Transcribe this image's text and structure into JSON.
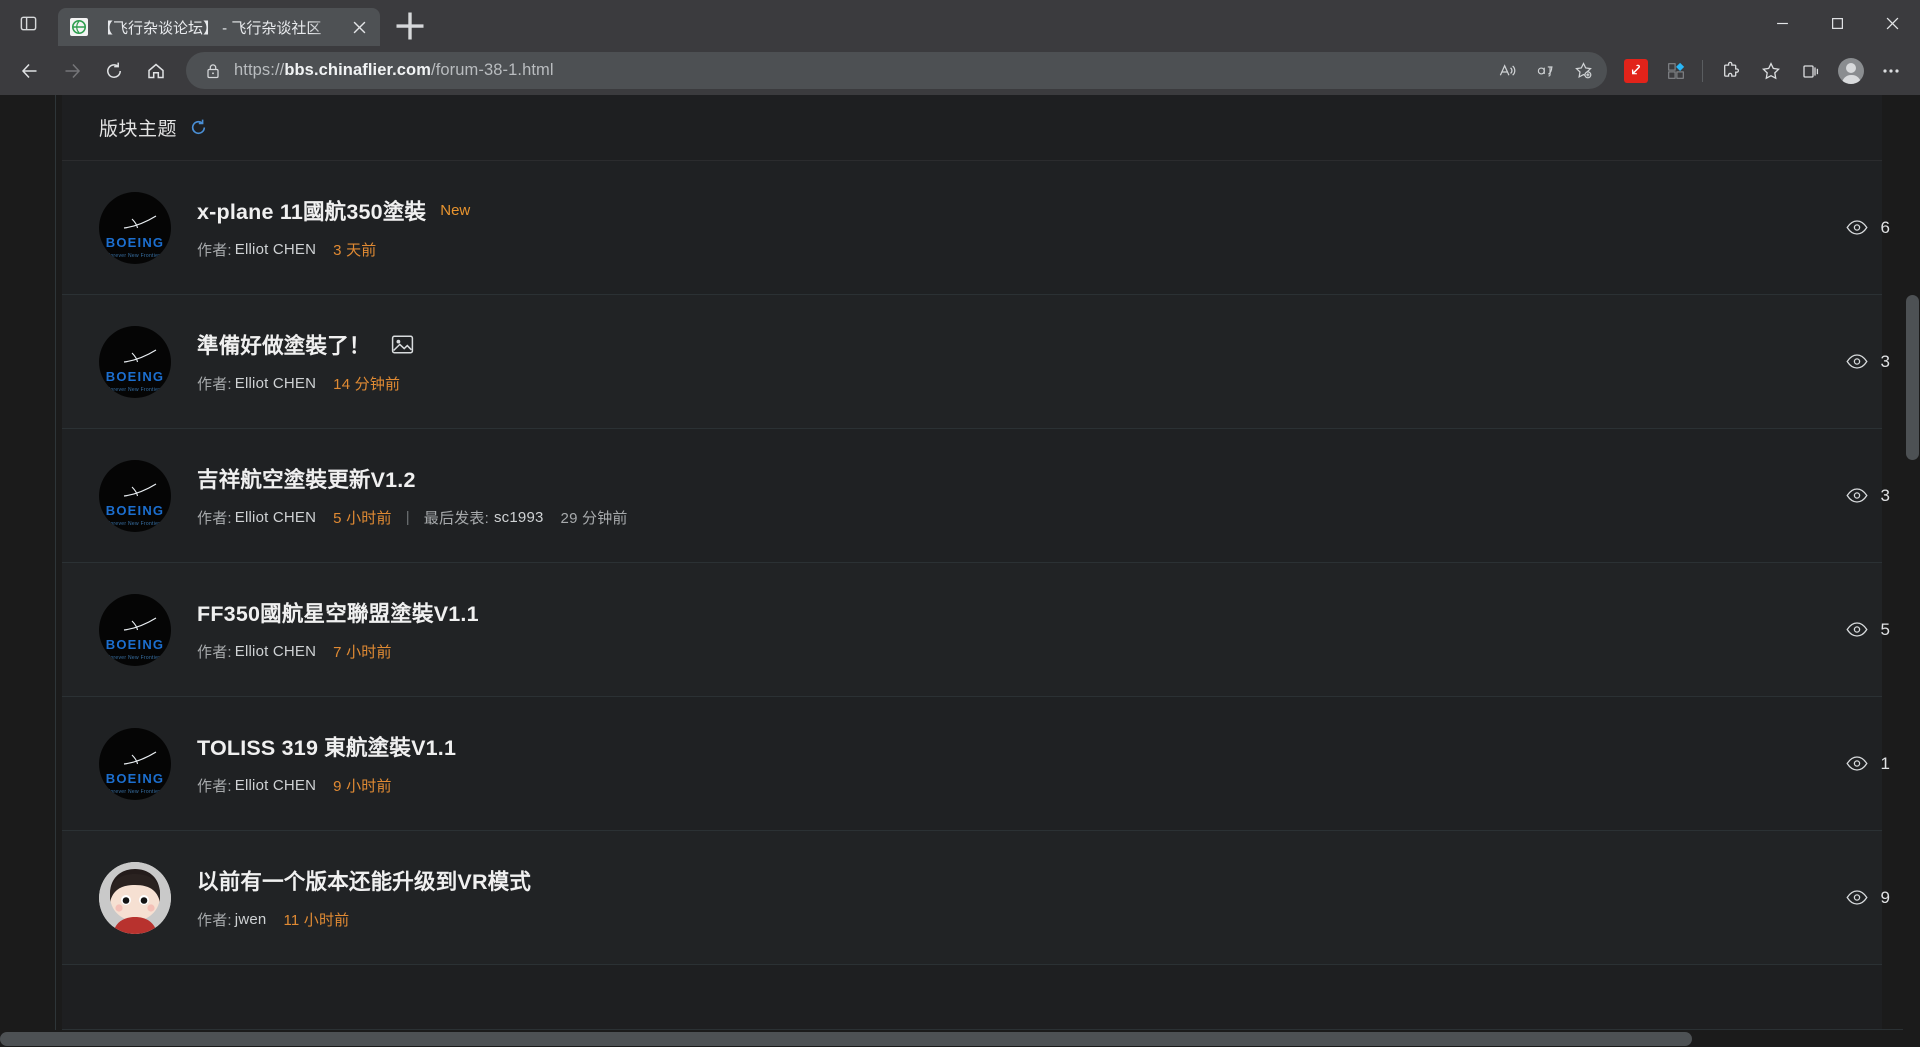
{
  "browser": {
    "tab": {
      "title": "【飞行杂谈论坛】 - 飞行杂谈社区",
      "favicon_name": "site-favicon",
      "close_label": "×"
    },
    "new_tab_label": "+",
    "address": {
      "url_scheme": "https://",
      "url_domain": "bbs.chinaflier.com",
      "url_path": "/forum-38-1.html",
      "full_url": "https://bbs.chinaflier.com/forum-38-1.html"
    },
    "toolbar_icons": [
      "read-aloud-icon",
      "translate-icon",
      "add-favorite-icon",
      "pdf-extension-icon",
      "extension-blue-icon",
      "extensions-puzzle-icon",
      "favorites-star-icon",
      "collections-icon",
      "profile-avatar-icon",
      "settings-more-icon"
    ],
    "nav": {
      "back": "back-arrow-icon",
      "forward": "forward-arrow-icon",
      "reload": "reload-icon",
      "home": "home-icon"
    },
    "window_controls": {
      "minimize": "minimize-icon",
      "maximize": "maximize-icon",
      "close": "close-icon"
    }
  },
  "forum": {
    "section_header": "版块主题",
    "refresh_icon": "refresh-icon",
    "meta_labels": {
      "author_prefix": "作者:",
      "last_post_prefix": "最后发表:",
      "separator": "|"
    },
    "threads": [
      {
        "title": "x-plane 11國航350塗裝",
        "badge": "New",
        "has_image_badge": false,
        "author": "Elliot CHEN",
        "time": "3 天前",
        "last_poster": null,
        "last_time": null,
        "views": "6",
        "avatar": "boeing"
      },
      {
        "title": "準備好做塗裝了！",
        "badge": null,
        "has_image_badge": true,
        "author": "Elliot CHEN",
        "time": "14 分钟前",
        "last_poster": null,
        "last_time": null,
        "views": "3",
        "avatar": "boeing"
      },
      {
        "title": "吉祥航空塗裝更新V1.2",
        "badge": null,
        "has_image_badge": false,
        "author": "Elliot CHEN",
        "time": "5 小时前",
        "last_poster": "sc1993",
        "last_time": "29 分钟前",
        "views": "3",
        "avatar": "boeing"
      },
      {
        "title": "FF350國航星空聯盟塗裝V1.1",
        "badge": null,
        "has_image_badge": false,
        "author": "Elliot CHEN",
        "time": "7 小时前",
        "last_poster": null,
        "last_time": null,
        "views": "5",
        "avatar": "boeing"
      },
      {
        "title": "TOLISS 319 東航塗裝V1.1",
        "badge": null,
        "has_image_badge": false,
        "author": "Elliot CHEN",
        "time": "9 小时前",
        "last_poster": null,
        "last_time": null,
        "views": "1",
        "avatar": "boeing"
      },
      {
        "title": "以前有一个版本还能升级到VR模式",
        "badge": null,
        "has_image_badge": false,
        "author": "jwen",
        "time": "11 小时前",
        "last_poster": null,
        "last_time": null,
        "views": "9",
        "avatar": "person"
      }
    ]
  },
  "colors": {
    "accent_orange": "#e08a33",
    "badge_new": "#e8942f",
    "page_bg": "#1e1f21",
    "chrome_bg": "#3b3b3e",
    "omnibox_bg": "#4d5053"
  }
}
